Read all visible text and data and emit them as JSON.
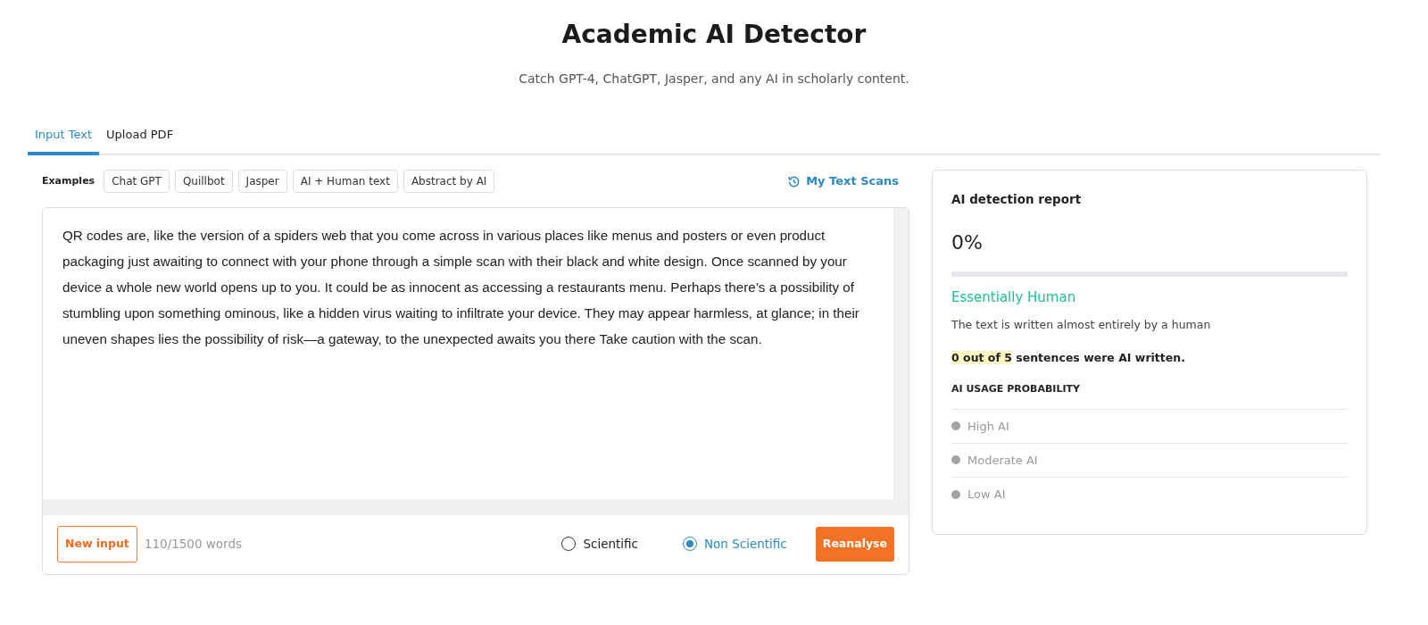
{
  "header": {
    "title": "Academic AI Detector",
    "subtitle": "Catch GPT-4, ChatGPT, Jasper, and any AI in scholarly content."
  },
  "tabs": [
    {
      "label": "Input Text",
      "selected": true
    },
    {
      "label": "Upload PDF",
      "selected": false
    }
  ],
  "examples": {
    "label": "Examples",
    "items": [
      "Chat GPT",
      "Quillbot",
      "Jasper",
      "AI + Human text",
      "Abstract by AI"
    ]
  },
  "scans_link": "My Text Scans",
  "input": {
    "value": "QR codes are, like the version of a spiders web that you come across in various places like menus and posters or even product packaging just awaiting to connect with your phone through a simple scan with their black and white design. Once scanned by your device a whole new world opens up to you. It could be as innocent as accessing a restaurants menu. Perhaps there’s a possibility of stumbling upon something ominous, like a hidden virus waiting to infiltrate your device. They may appear harmless, at glance; in their uneven shapes lies the possibility of risk—a gateway, to the unexpected awaits you there Take caution with the scan."
  },
  "footer": {
    "new_input": "New input",
    "word_count": "110/1500 words",
    "modes": [
      {
        "label": "Scientific",
        "selected": false
      },
      {
        "label": "Non Scientific",
        "selected": true
      }
    ],
    "reanalyse": "Reanalyse"
  },
  "report": {
    "title": "AI detection report",
    "score": "0%",
    "level": 0,
    "verdict": "Essentially Human",
    "description": "The text is written almost entirely by a human",
    "sentences_highlight": "0 out of 5",
    "sentences_rest": "sentences were AI written.",
    "probability_heading": "AI USAGE PROBABILITY",
    "probability_items": [
      "High AI",
      "Moderate AI",
      "Low AI"
    ]
  }
}
